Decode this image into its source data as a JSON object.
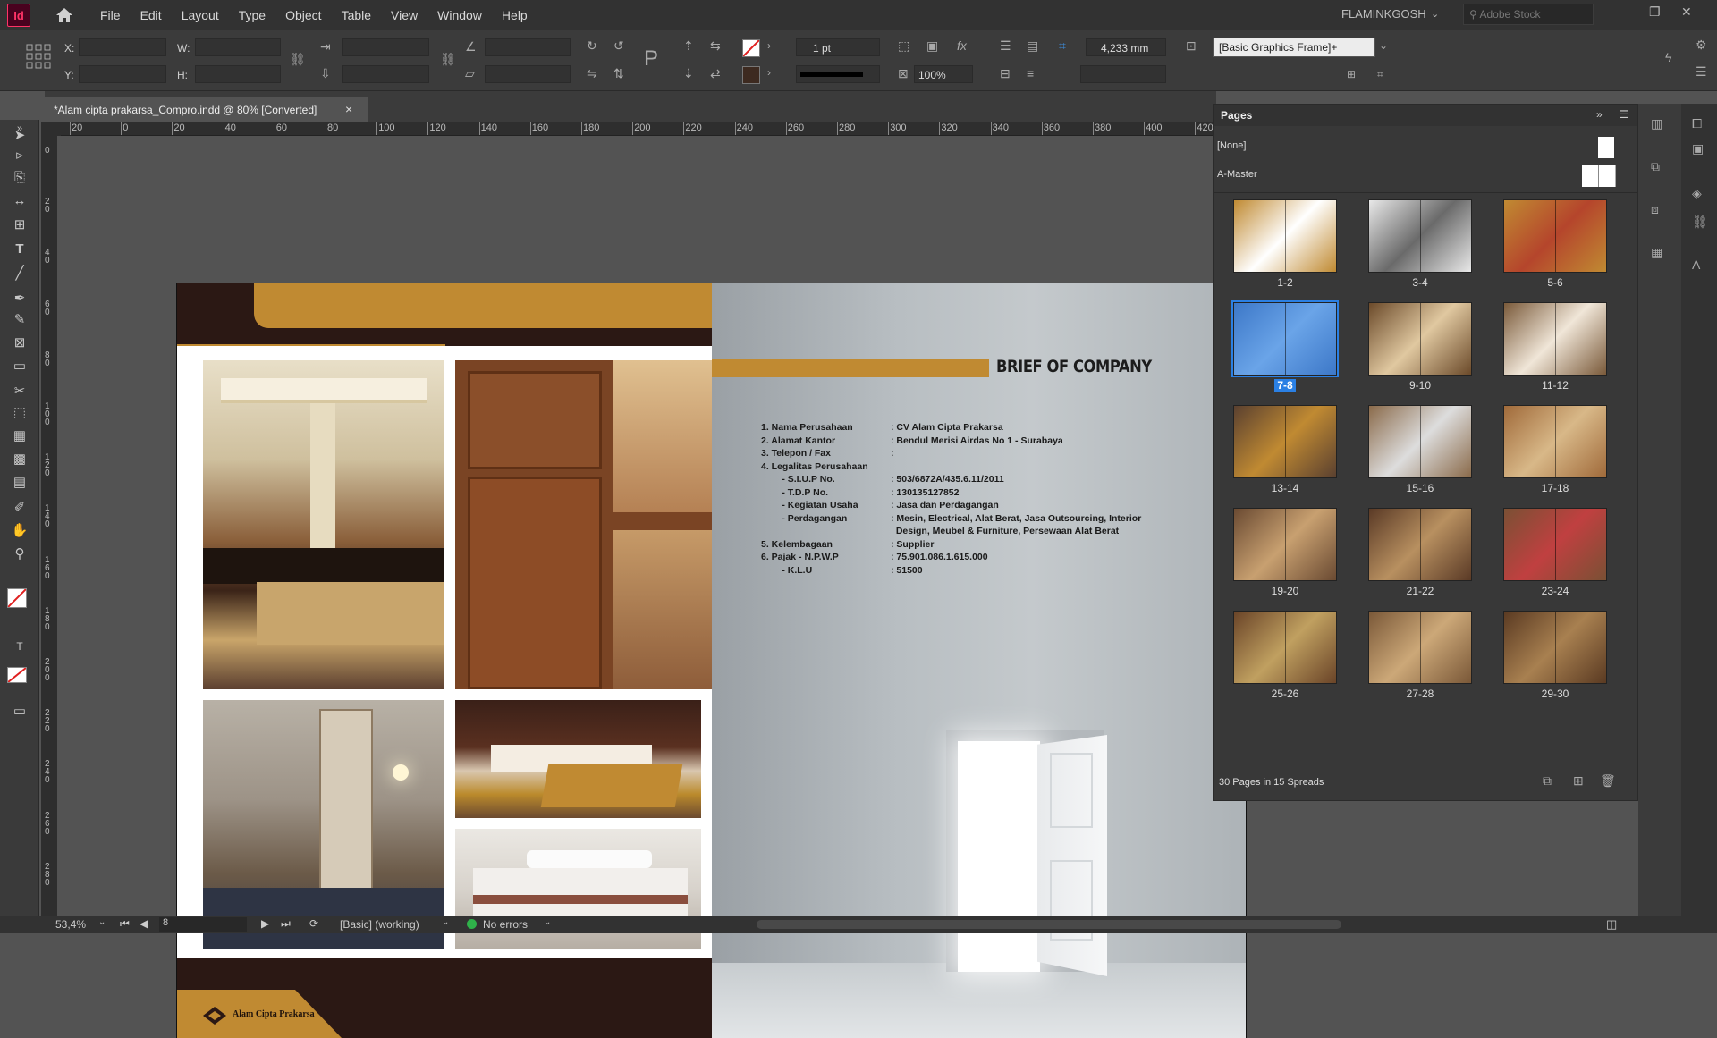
{
  "menubar": {
    "app_icon": "Id",
    "items": [
      "File",
      "Edit",
      "Layout",
      "Type",
      "Object",
      "Table",
      "View",
      "Window",
      "Help"
    ],
    "user": "FLAMINKGOSH",
    "stock_placeholder": "Adobe Stock"
  },
  "control": {
    "x_label": "X:",
    "y_label": "Y:",
    "w_label": "W:",
    "h_label": "H:",
    "stroke_weight": "1 pt",
    "opacity": "100%",
    "gap": "4,233 mm",
    "object_style": "[Basic Graphics Frame]+"
  },
  "document": {
    "tab_title": "*Alam cipta prakarsa_Compro.indd @ 80% [Converted]",
    "tab_close": "×"
  },
  "ruler": {
    "h_ticks": [
      "20",
      "0",
      "20",
      "40",
      "60",
      "80",
      "100",
      "120",
      "140",
      "160",
      "180",
      "200",
      "220",
      "240",
      "260",
      "280",
      "300",
      "320",
      "340",
      "360",
      "380",
      "400",
      "420"
    ],
    "v_ticks": [
      "0",
      "20",
      "40",
      "60",
      "80",
      "100",
      "120",
      "140",
      "160",
      "180",
      "200",
      "220",
      "240",
      "260",
      "280"
    ]
  },
  "spread": {
    "left_page": {
      "logo_text": "Alam Cipta Prakarsa"
    },
    "right_page": {
      "title": "BRIEF OF COMPANY",
      "rows": [
        {
          "k": "1. Nama Perusahaan",
          "v": ": CV Alam Cipta Prakarsa"
        },
        {
          "k": "2. Alamat Kantor",
          "v": ": Bendul Merisi Airdas No 1 - Surabaya"
        },
        {
          "k": "3. Telepon / Fax",
          "v": ":"
        },
        {
          "k": "4. Legalitas Perusahaan",
          "v": ""
        },
        {
          "k": "        - S.I.U.P No.",
          "v": ": 503/6872A/435.6.11/2011"
        },
        {
          "k": "        - T.D.P No.",
          "v": ": 130135127852"
        },
        {
          "k": "        - Kegiatan Usaha",
          "v": ": Jasa dan Perdagangan"
        },
        {
          "k": "        - Perdagangan",
          "v": ": Mesin, Electrical, Alat Berat, Jasa Outsourcing, Interior"
        },
        {
          "k": "",
          "v": "  Design, Meubel & Furniture, Persewaan Alat Berat"
        },
        {
          "k": "5. Kelembagaan",
          "v": ": Supplier"
        },
        {
          "k": "6. Pajak - N.P.W.P",
          "v": ": 75.901.086.1.615.000"
        },
        {
          "k": "        - K.L.U",
          "v": ": 51500"
        }
      ]
    }
  },
  "pages_panel": {
    "title": "Pages",
    "masters": [
      "[None]",
      "A-Master"
    ],
    "spreads": [
      "1-2",
      "3-4",
      "5-6",
      "7-8",
      "9-10",
      "11-12",
      "13-14",
      "15-16",
      "17-18",
      "19-20",
      "21-22",
      "23-24",
      "25-26",
      "27-28",
      "29-30"
    ],
    "selected": "7-8",
    "footer": "30 Pages in 15 Spreads"
  },
  "status": {
    "zoom": "53,4%",
    "page": "8",
    "preflight_profile": "[Basic] (working)",
    "errors": "No errors"
  },
  "colors": {
    "accent_gold": "#c08a32",
    "dark_brown": "#2b1814",
    "selected_blue": "#2b80e4"
  }
}
